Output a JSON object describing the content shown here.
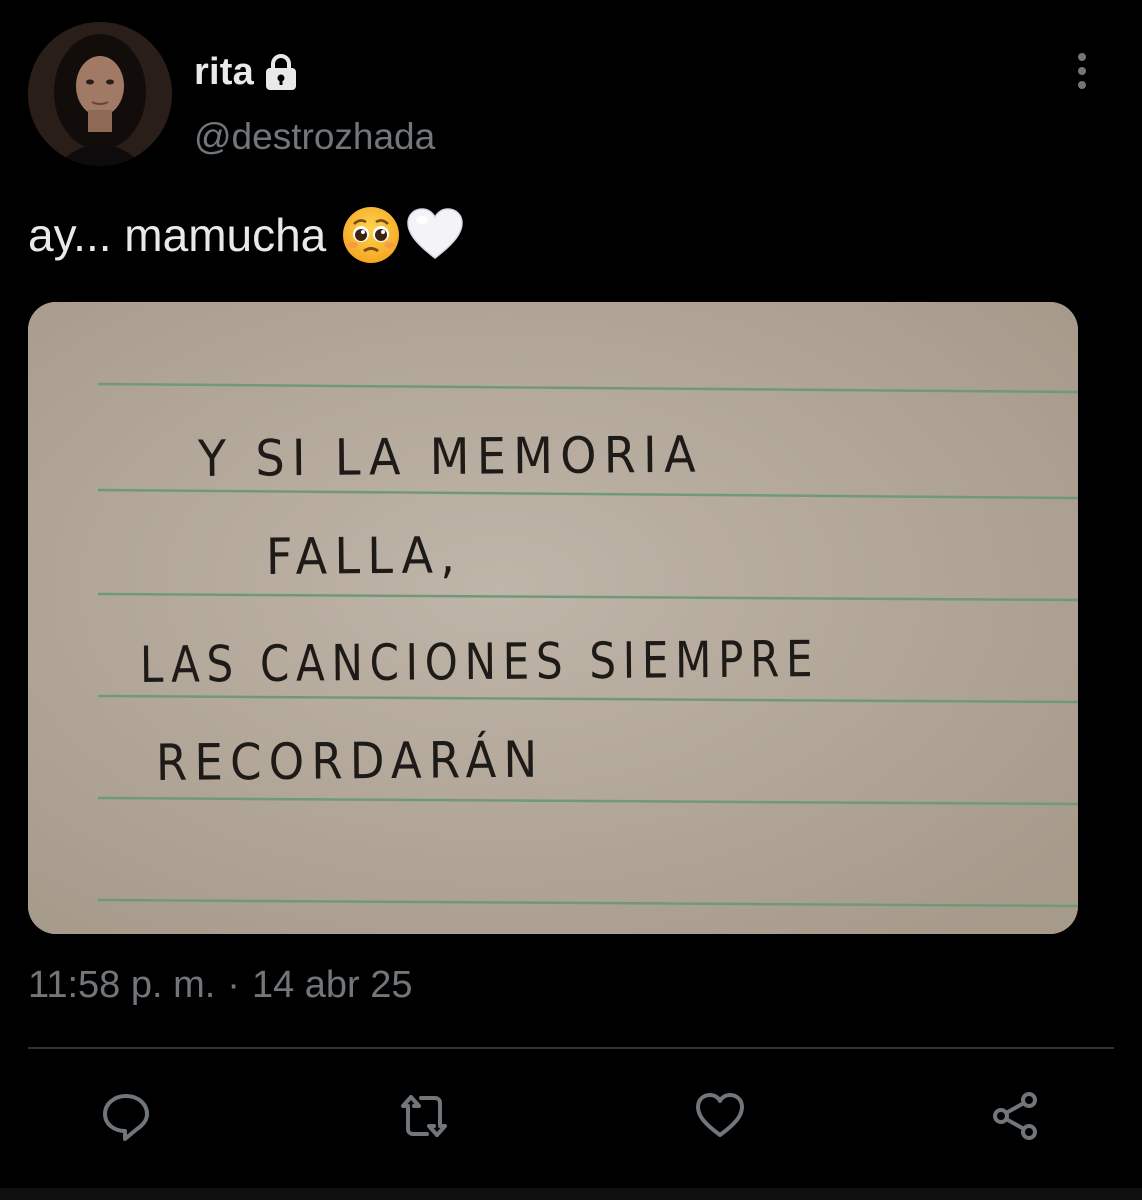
{
  "author": {
    "display_name": "rita",
    "handle": "@destrozhada",
    "protected_icon": "lock-icon",
    "avatar": "profile-photo"
  },
  "tweet": {
    "text": "ay... mamucha",
    "emojis": [
      "pleading-face-emoji",
      "white-heart-emoji"
    ],
    "media": {
      "lines": [
        "Y SI LA MEMORIA",
        "FALLA,",
        "LAS CANCIONES SIEMPRE",
        "RECORDARÁN"
      ]
    },
    "time": "11:58 p. m.",
    "separator": "·",
    "date": "14 abr 25"
  },
  "actions": [
    "reply-icon",
    "retweet-icon",
    "like-icon",
    "share-icon"
  ],
  "colors": {
    "background": "#000000",
    "primary_text": "#e7e9ea",
    "secondary_text": "#71767b",
    "divider": "#2f3336",
    "paper": "#b3a89a",
    "ruled_line": "#6f9a7a"
  },
  "more_icon": "more-vertical-icon"
}
